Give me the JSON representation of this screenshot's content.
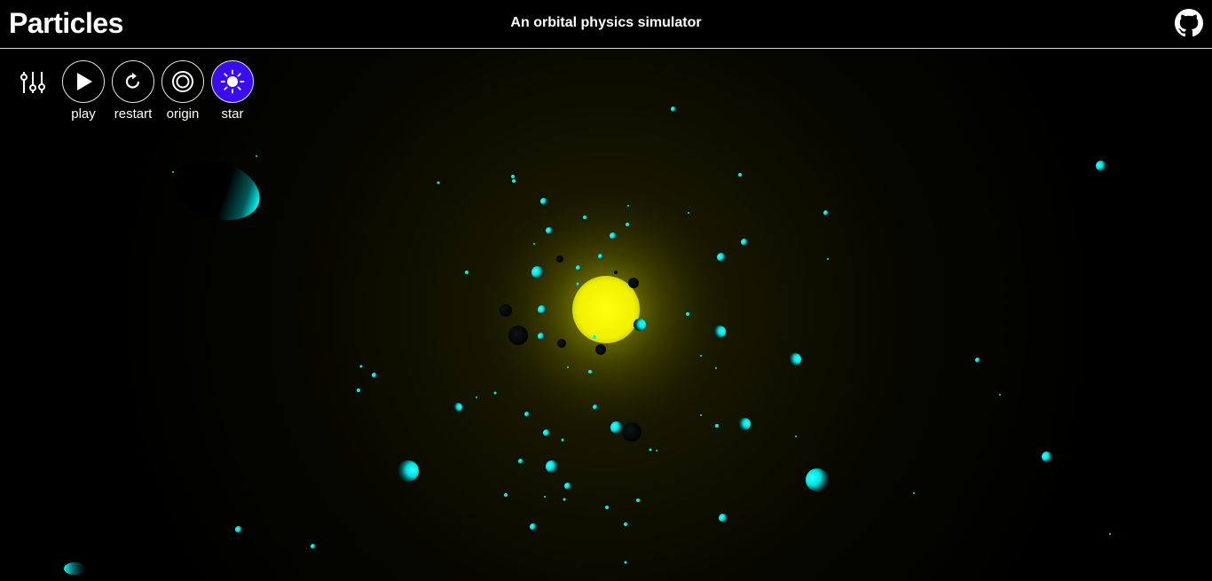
{
  "header": {
    "title": "Particles",
    "subtitle": "An orbital physics simulator",
    "github_icon": "github-icon"
  },
  "toolbar": {
    "settings_icon": "sliders-icon",
    "buttons": [
      {
        "id": "play",
        "label": "play",
        "icon": "play-icon",
        "active": false
      },
      {
        "id": "restart",
        "label": "restart",
        "icon": "restart-icon",
        "active": false
      },
      {
        "id": "origin",
        "label": "origin",
        "icon": "origin-icon",
        "active": false
      },
      {
        "id": "star",
        "label": "star",
        "icon": "sun-icon",
        "active": true
      }
    ]
  },
  "colors": {
    "background": "#000000",
    "star": "#f2f200",
    "particle": "#00ffff",
    "active_button": "#3a0cf4",
    "header_border": "#d8d8d8"
  }
}
